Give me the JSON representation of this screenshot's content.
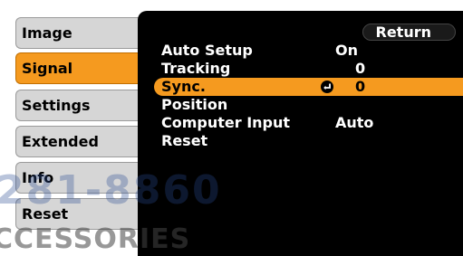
{
  "tabs": [
    {
      "label": "Image"
    },
    {
      "label": "Signal"
    },
    {
      "label": "Settings"
    },
    {
      "label": "Extended"
    },
    {
      "label": "Info"
    },
    {
      "label": "Reset"
    }
  ],
  "active_tab": "Signal",
  "return_label": "Return",
  "rows": [
    {
      "label": "Auto Setup",
      "value": "On"
    },
    {
      "label": "Tracking",
      "value": "0"
    },
    {
      "label": "Sync.",
      "value": "0"
    },
    {
      "label": "Position",
      "value": ""
    },
    {
      "label": "Computer Input",
      "value": "Auto"
    },
    {
      "label": "Reset",
      "value": ""
    }
  ],
  "selected_row": "Sync.",
  "watermark": {
    "line1": "281-8860",
    "line2": "CCESSORIES"
  },
  "colors": {
    "accent": "#f59a1f",
    "panel": "#000000",
    "tab": "#d6d6d6"
  }
}
